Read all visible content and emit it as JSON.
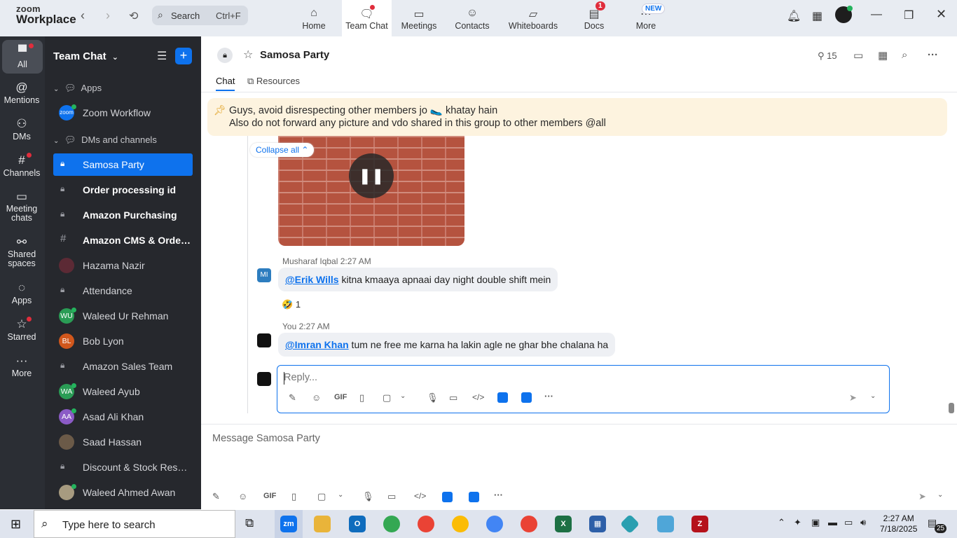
{
  "app": {
    "brand_line1": "zoom",
    "brand_line2": "Workplace"
  },
  "topbar": {
    "search_label": "Search",
    "search_shortcut": "Ctrl+F",
    "tabs": [
      {
        "label": "Home",
        "icon": "home-icon"
      },
      {
        "label": "Team Chat",
        "icon": "chat-icon"
      },
      {
        "label": "Meetings",
        "icon": "video-icon"
      },
      {
        "label": "Contacts",
        "icon": "contacts-icon"
      },
      {
        "label": "Whiteboards",
        "icon": "whiteboard-icon"
      },
      {
        "label": "Docs",
        "icon": "docs-icon",
        "badge": "1"
      },
      {
        "label": "More",
        "icon": "more-icon",
        "badge": "NEW"
      }
    ]
  },
  "rail": {
    "items": [
      {
        "label": "All"
      },
      {
        "label": "Mentions"
      },
      {
        "label": "DMs"
      },
      {
        "label": "Channels"
      },
      {
        "label": "Meeting chats"
      },
      {
        "label": "Shared spaces"
      },
      {
        "label": "Apps"
      },
      {
        "label": "Starred"
      },
      {
        "label": "More"
      }
    ]
  },
  "sidebar": {
    "title": "Team Chat",
    "group_apps": "Apps",
    "group_dms": "DMs and channels",
    "app_item": "Zoom Workflow",
    "app_item_avatar": "zoom",
    "items": [
      {
        "name": "Samosa Party",
        "type": "lock"
      },
      {
        "name": "Order processing id",
        "type": "lock"
      },
      {
        "name": "Amazon Purchasing",
        "type": "lock"
      },
      {
        "name": "Amazon CMS & Order...",
        "type": "hash"
      },
      {
        "name": "Hazama Nazir",
        "type": "photo"
      },
      {
        "name": "Attendance",
        "type": "lock"
      },
      {
        "name": "Waleed Ur Rehman",
        "type": "initials",
        "initials": "WU"
      },
      {
        "name": "Bob Lyon",
        "type": "initials",
        "initials": "BL"
      },
      {
        "name": "Amazon Sales Team",
        "type": "lock"
      },
      {
        "name": "Waleed Ayub",
        "type": "initials",
        "initials": "WA"
      },
      {
        "name": "Asad Ali Khan",
        "type": "initials",
        "initials": "AA"
      },
      {
        "name": "Saad Hassan",
        "type": "photo"
      },
      {
        "name": "Discount & Stock Reser...",
        "type": "lock"
      },
      {
        "name": "Waleed Ahmed Awan",
        "type": "photo"
      }
    ]
  },
  "chat": {
    "title": "Samosa Party",
    "member_count": "15",
    "tab_chat": "Chat",
    "tab_resources": "Resources",
    "pinned_line1": "Guys, avoid disrespecting other members jo 🥿 khatay hain",
    "pinned_line2": "Also do not forward any picture and vdo shared in this group to other members @all",
    "collapse_label": "Collapse all",
    "messages": [
      {
        "sender": "Musharaf Iqbal",
        "time": "2:27 AM",
        "avatar": "MI",
        "mention": "@Erik Wills",
        "text": " kitna kmaaya apnaai day night double shift mein",
        "reaction": "🤣",
        "reaction_count": "1"
      },
      {
        "sender": "You",
        "time": "2:27 AM",
        "mention": "@Imran Khan",
        "text": " tum ne free me karna ha lakin agle ne ghar bhe chalana ha"
      }
    ],
    "reply_placeholder": "Reply...",
    "message_placeholder": "Message Samosa Party",
    "gif_label": "GIF"
  },
  "taskbar": {
    "search_placeholder": "Type here to search",
    "time": "2:27 AM",
    "date": "7/18/2025",
    "notification_count": "25"
  },
  "colors": {
    "accent": "#0e72ed",
    "sidebar_bg": "#26282d",
    "rail_bg": "#2b2e34",
    "pinned_bg": "#fdf3df"
  }
}
